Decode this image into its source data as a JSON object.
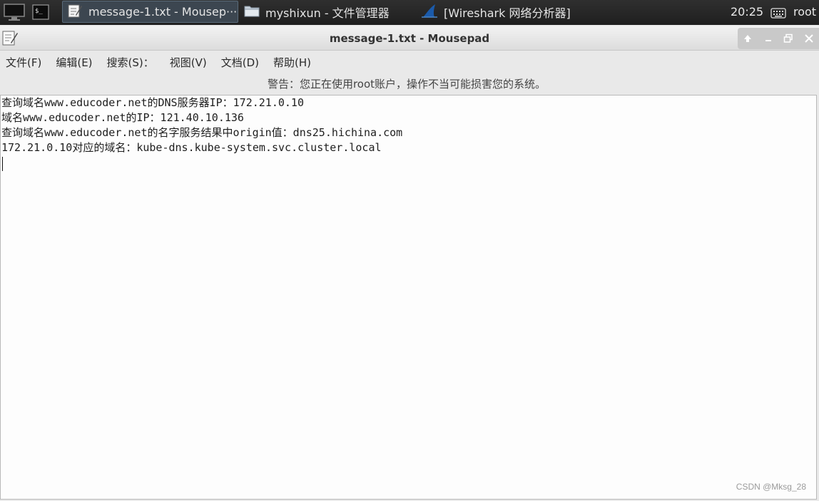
{
  "taskbar": {
    "tasks": [
      {
        "label": "message-1.txt - Mousep···",
        "icon": "text-editor-icon",
        "active": true
      },
      {
        "label": "myshixun - 文件管理器",
        "icon": "folder-icon",
        "active": false
      },
      {
        "label": "[Wireshark 网络分析器]",
        "icon": "wireshark-fin-icon",
        "active": false
      }
    ],
    "clock": "20:25",
    "user": "root"
  },
  "window": {
    "title": "message-1.txt - Mousepad",
    "menu": [
      "文件(F)",
      "编辑(E)",
      "搜索(S)：",
      "视图(V)",
      "文档(D)",
      "帮助(H)"
    ],
    "warning": "警告：您正在使用root账户，操作不当可能损害您的系统。"
  },
  "editor": {
    "lines": [
      "查询域名www.educoder.net的DNS服务器IP：172.21.0.10",
      "域名www.educoder.net的IP：121.40.10.136",
      "查询域名www.educoder.net的名字服务结果中origin值：dns25.hichina.com",
      "172.21.0.10对应的域名：kube-dns.kube-system.svc.cluster.local"
    ]
  },
  "watermark": "CSDN @Mksg_28"
}
